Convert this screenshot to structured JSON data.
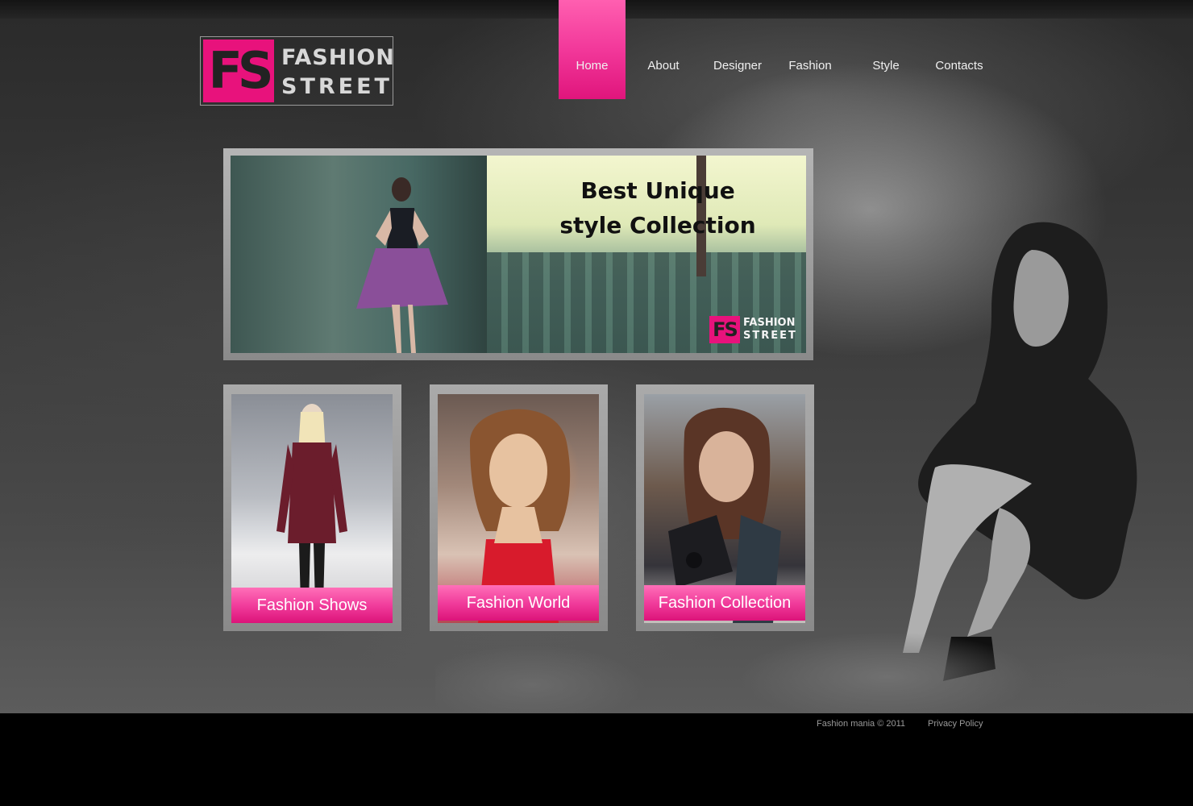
{
  "brand": {
    "mark": "FS",
    "word1": "FASHION",
    "word2": "STREET",
    "accent_color": "#e8127c"
  },
  "nav": {
    "items": [
      {
        "label": "Home",
        "active": true
      },
      {
        "label": "About",
        "active": false
      },
      {
        "label": "Designer",
        "active": false
      },
      {
        "label": "Fashion",
        "active": false
      },
      {
        "label": "Style",
        "active": false
      },
      {
        "label": "Contacts",
        "active": false
      }
    ]
  },
  "banner": {
    "title_line1": "Best Unique",
    "title_line2": "style Collection",
    "logo_mark": "FS",
    "logo_word1": "FASHION",
    "logo_word2": "STREET"
  },
  "cards": [
    {
      "label": "Fashion Shows"
    },
    {
      "label": "Fashion World"
    },
    {
      "label": "Fashion Collection"
    }
  ],
  "footer": {
    "copyright": "Fashion mania © 2011",
    "privacy": "Privacy Policy"
  }
}
